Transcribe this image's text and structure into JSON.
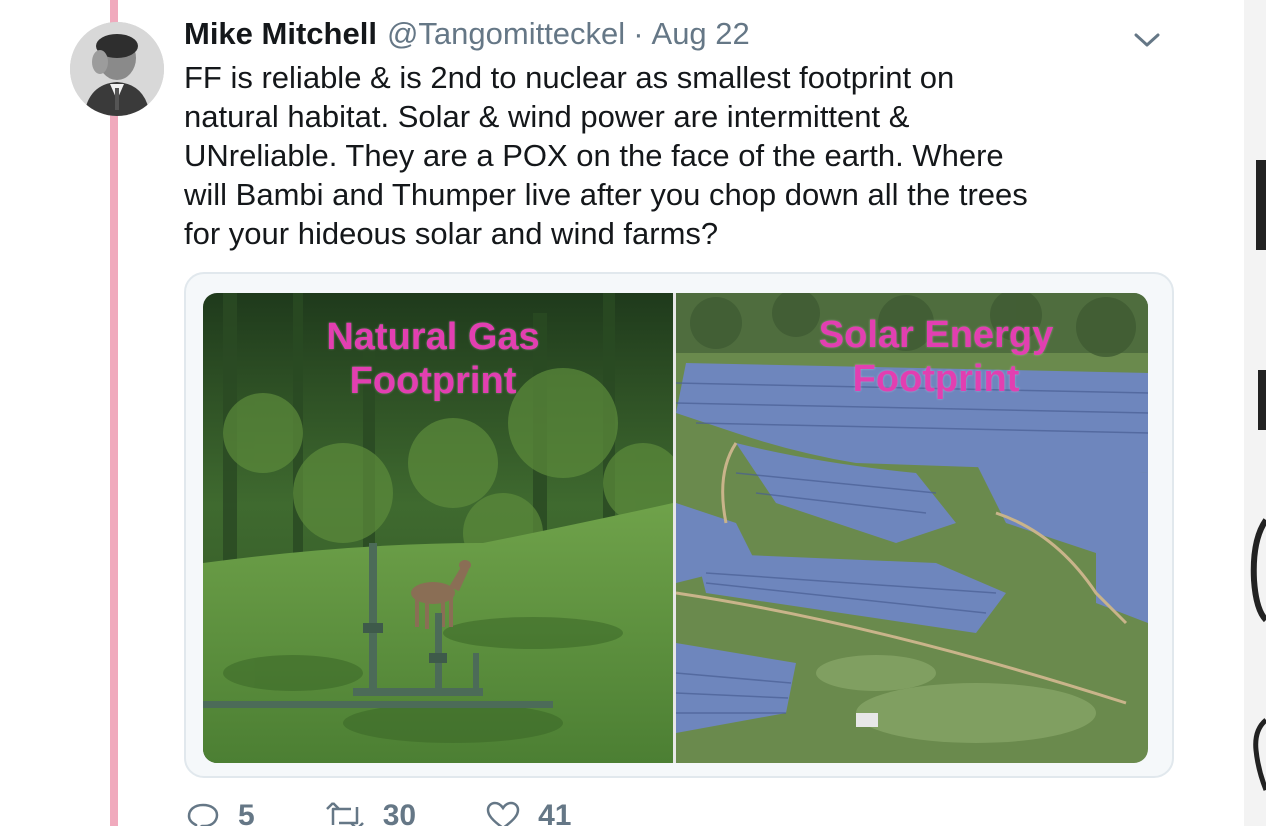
{
  "tweet": {
    "author_name": "Mike Mitchell",
    "handle": "@Tangomitteckel",
    "separator": "·",
    "date": "Aug 22",
    "text_lines": [
      "FF is reliable & is 2nd to nuclear as smallest footprint on",
      "natural habitat.  Solar & wind power are intermittent &",
      "UNreliable. They are a POX on the face of the earth.  Where",
      "will Bambi and Thumper live after you chop down all the trees",
      "for your hideous solar and wind farms?"
    ],
    "media": {
      "left_label": [
        "Natural Gas",
        "Footprint"
      ],
      "right_label": [
        "Solar Energy",
        "Footprint"
      ],
      "label_color": "#e23fb1"
    },
    "actions": {
      "reply_count": "5",
      "retweet_count": "30",
      "like_count": "41"
    },
    "icons": [
      "chevron-down-icon",
      "reply-icon",
      "retweet-icon",
      "like-icon"
    ]
  },
  "colors": {
    "thread_line": "#f0aabd",
    "secondary_text": "#657786",
    "primary_text": "#14171a",
    "card_border": "#e1e8ed"
  }
}
